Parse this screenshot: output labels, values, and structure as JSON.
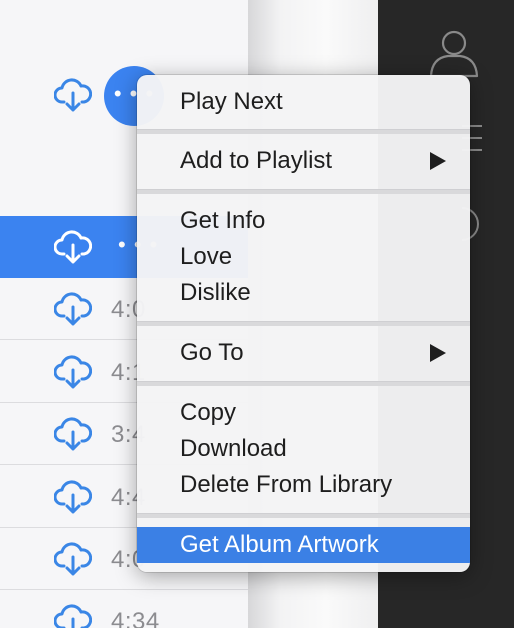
{
  "track_list": {
    "more_button_label": "• • •",
    "rows": [
      {
        "time": "",
        "selected": true,
        "dots": "• • •"
      },
      {
        "time": "4:0",
        "selected": false
      },
      {
        "time": "4:1",
        "selected": false
      },
      {
        "time": "3:4",
        "selected": false
      },
      {
        "time": "4:4",
        "selected": false
      },
      {
        "time": "4:0",
        "selected": false
      },
      {
        "time": "4:34",
        "selected": false
      }
    ]
  },
  "context_menu": {
    "items": {
      "play_next": "Play Next",
      "add_to_playlist": "Add to Playlist",
      "get_info": "Get Info",
      "love": "Love",
      "dislike": "Dislike",
      "go_to": "Go To",
      "copy": "Copy",
      "download": "Download",
      "delete_from_library": "Delete From Library",
      "get_album_artwork": "Get Album Artwork"
    },
    "highlighted_item": "Get Album Artwork"
  },
  "colors": {
    "accent": "#3b83f0",
    "menu_highlight": "#3b80e5",
    "sidebar_bg": "#272727",
    "icon_blue": "#3a86e6"
  },
  "icons": [
    "cloud-download-icon",
    "more-dots-icon",
    "profile-icon",
    "list-icon",
    "submenu-arrow-icon"
  ]
}
